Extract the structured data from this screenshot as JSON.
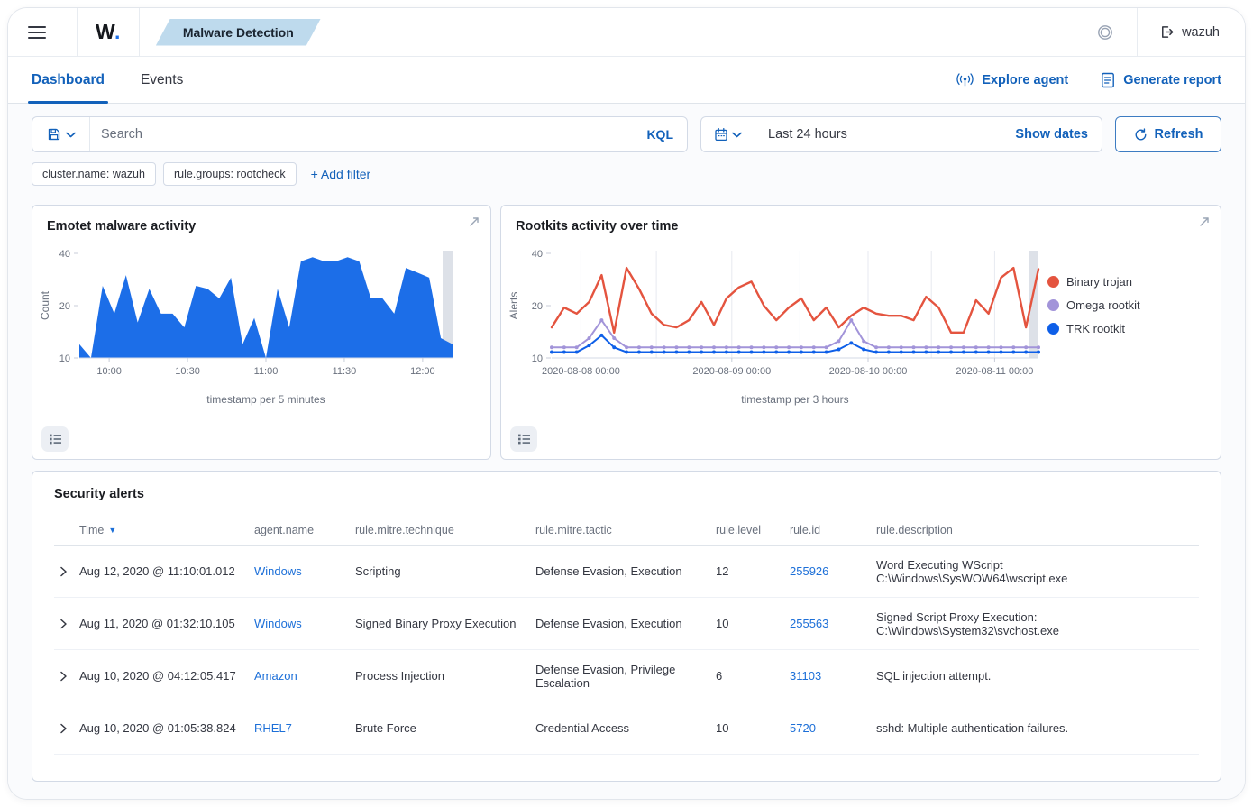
{
  "colors": {
    "accent": "#1261ba",
    "link": "#1c6fd8",
    "area_blue": "#1c6ee8",
    "binary_trojan": "#e4543f",
    "omega_rootkit": "#a294d9",
    "trk_rootkit": "#0e5fe8"
  },
  "header": {
    "logo": "W",
    "logo_dot": ".",
    "breadcrumb": "Malware Detection",
    "user": "wazuh"
  },
  "tabs": [
    {
      "label": "Dashboard",
      "active": true
    },
    {
      "label": "Events",
      "active": false
    }
  ],
  "actions": {
    "explore_agent": "Explore agent",
    "generate_report": "Generate report"
  },
  "toolbar": {
    "search_placeholder": "Search",
    "kql_label": "KQL",
    "time_range": "Last 24 hours",
    "show_dates_label": "Show dates",
    "refresh_label": "Refresh"
  },
  "filters": {
    "pills": [
      "cluster.name: wazuh",
      "rule.groups: rootcheck"
    ],
    "add_label": "+ Add filter"
  },
  "chart_data": [
    {
      "type": "area",
      "title": "Emotet malware activity",
      "xlabel": "timestamp per 5 minutes",
      "ylabel": "Count",
      "y_scale": "log",
      "ylim": [
        10,
        40
      ],
      "y_ticks": [
        40,
        20,
        10
      ],
      "x_ticks": [
        "10:00",
        "10:30",
        "11:00",
        "11:30",
        "12:00"
      ],
      "x_tick_fractions": [
        0.08,
        0.29,
        0.5,
        0.71,
        0.92
      ],
      "color": "#1c6ee8",
      "values": [
        12,
        10,
        26,
        18,
        30,
        16,
        25,
        18,
        18,
        15,
        26,
        25,
        22,
        29,
        12,
        17,
        10,
        25,
        15,
        36,
        38,
        36,
        36,
        38,
        36,
        22,
        22,
        18,
        33,
        31,
        29,
        13,
        12
      ]
    },
    {
      "type": "line",
      "title": "Rootkits activity over time",
      "xlabel": "timestamp per 3 hours",
      "ylabel": "Alerts",
      "y_scale": "log",
      "ylim": [
        10,
        40
      ],
      "y_ticks": [
        40,
        20,
        10
      ],
      "x_ticks": [
        "2020-08-08 00:00",
        "2020-08-09 00:00",
        "2020-08-10 00:00",
        "2020-08-11 00:00"
      ],
      "x_tick_fractions": [
        0.06,
        0.37,
        0.65,
        0.91
      ],
      "legend_position": "right",
      "grid": true,
      "series": [
        {
          "name": "Binary trojan",
          "color": "#e4543f",
          "values": [
            15,
            19.5,
            18,
            21,
            30,
            14,
            33,
            25,
            18,
            15.5,
            15,
            16.5,
            21,
            15.5,
            22,
            25.5,
            27.5,
            20,
            16.5,
            19.5,
            22,
            16.5,
            19.5,
            15,
            17.5,
            19.5,
            18,
            17.5,
            17.5,
            16.5,
            22.5,
            19.5,
            14,
            14,
            21.5,
            18,
            29,
            33,
            15,
            32.5
          ]
        },
        {
          "name": "Omega rootkit",
          "color": "#a294d9",
          "values": [
            11.5,
            11.5,
            11.5,
            13,
            16.5,
            13,
            11.5,
            11.5,
            11.5,
            11.5,
            11.5,
            11.5,
            11.5,
            11.5,
            11.5,
            11.5,
            11.5,
            11.5,
            11.5,
            11.5,
            11.5,
            11.5,
            11.5,
            12.5,
            16.5,
            12.5,
            11.5,
            11.5,
            11.5,
            11.5,
            11.5,
            11.5,
            11.5,
            11.5,
            11.5,
            11.5,
            11.5,
            11.5,
            11.5,
            11.5
          ]
        },
        {
          "name": "TRK rootkit",
          "color": "#0e5fe8",
          "values": [
            10.8,
            10.8,
            10.8,
            11.8,
            13.5,
            11.5,
            10.8,
            10.8,
            10.8,
            10.8,
            10.8,
            10.8,
            10.8,
            10.8,
            10.8,
            10.8,
            10.8,
            10.8,
            10.8,
            10.8,
            10.8,
            10.8,
            10.8,
            11.2,
            12.2,
            11.2,
            10.8,
            10.8,
            10.8,
            10.8,
            10.8,
            10.8,
            10.8,
            10.8,
            10.8,
            10.8,
            10.8,
            10.8,
            10.8,
            10.8
          ]
        }
      ]
    }
  ],
  "alerts_table": {
    "title": "Security alerts",
    "columns": [
      "Time",
      "agent.name",
      "rule.mitre.technique",
      "rule.mitre.tactic",
      "rule.level",
      "rule.id",
      "rule.description"
    ],
    "rows": [
      {
        "time": "Aug 12, 2020 @ 11:10:01.012",
        "agent": "Windows",
        "technique": "Scripting",
        "tactic": "Defense Evasion, Execution",
        "level": "12",
        "id": "255926",
        "description": "Word Executing WScript C:\\Windows\\SysWOW64\\wscript.exe"
      },
      {
        "time": "Aug 11, 2020 @ 01:32:10.105",
        "agent": "Windows",
        "technique": "Signed Binary Proxy Execution",
        "tactic": "Defense Evasion, Execution",
        "level": "10",
        "id": "255563",
        "description": "Signed Script Proxy Execution: C:\\Windows\\System32\\svchost.exe"
      },
      {
        "time": "Aug 10, 2020 @ 04:12:05.417",
        "agent": "Amazon",
        "technique": "Process Injection",
        "tactic": "Defense Evasion, Privilege Escalation",
        "level": "6",
        "id": "31103",
        "description": "SQL injection attempt."
      },
      {
        "time": "Aug 10, 2020 @ 01:05:38.824",
        "agent": "RHEL7",
        "technique": "Brute Force",
        "tactic": "Credential Access",
        "level": "10",
        "id": "5720",
        "description": "sshd: Multiple authentication failures."
      }
    ]
  }
}
